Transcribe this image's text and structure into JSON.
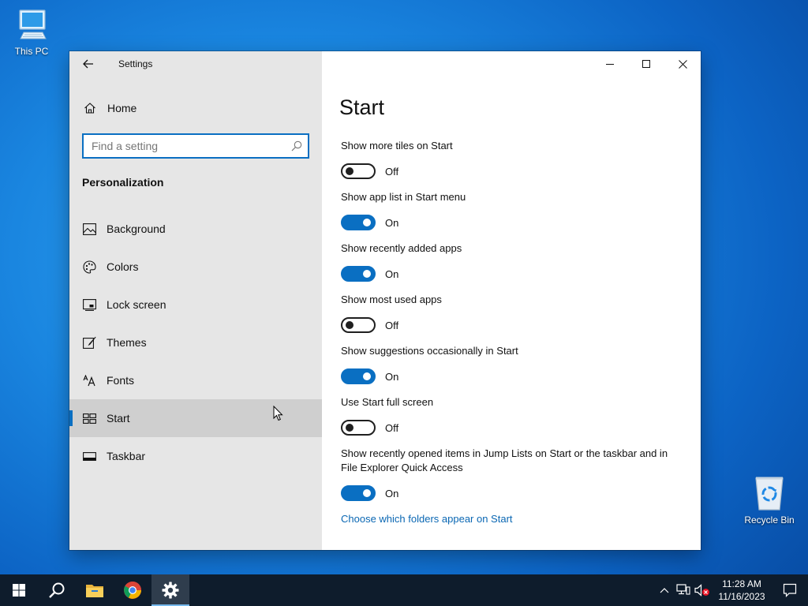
{
  "desktop": {
    "icons": [
      {
        "label": "This PC"
      },
      {
        "label": "Recycle Bin"
      }
    ]
  },
  "window": {
    "app_title": "Settings",
    "nav": {
      "home_label": "Home",
      "search_placeholder": "Find a setting",
      "section_title": "Personalization",
      "items": [
        {
          "label": "Background",
          "icon": "image-icon"
        },
        {
          "label": "Colors",
          "icon": "palette-icon"
        },
        {
          "label": "Lock screen",
          "icon": "lock-screen-icon"
        },
        {
          "label": "Themes",
          "icon": "brush-icon"
        },
        {
          "label": "Fonts",
          "icon": "fonts-icon"
        },
        {
          "label": "Start",
          "icon": "start-tiles-icon",
          "selected": true
        },
        {
          "label": "Taskbar",
          "icon": "taskbar-icon"
        }
      ]
    },
    "content": {
      "title": "Start",
      "settings": [
        {
          "label": "Show more tiles on Start",
          "state": "Off",
          "on": false
        },
        {
          "label": "Show app list in Start menu",
          "state": "On",
          "on": true
        },
        {
          "label": "Show recently added apps",
          "state": "On",
          "on": true
        },
        {
          "label": "Show most used apps",
          "state": "Off",
          "on": false
        },
        {
          "label": "Show suggestions occasionally in Start",
          "state": "On",
          "on": true
        },
        {
          "label": "Use Start full screen",
          "state": "Off",
          "on": false
        },
        {
          "label": "Show recently opened items in Jump Lists on Start or the taskbar and in File Explorer Quick Access",
          "state": "On",
          "on": true
        }
      ],
      "link": "Choose which folders appear on Start"
    }
  },
  "taskbar": {
    "time": "11:28 AM",
    "date": "11/16/2023"
  },
  "colors": {
    "accent": "#0a6fc2",
    "link": "#0a67b3",
    "nav_bg": "#e6e6e6",
    "taskbar_bg": "#0e1c2c"
  }
}
